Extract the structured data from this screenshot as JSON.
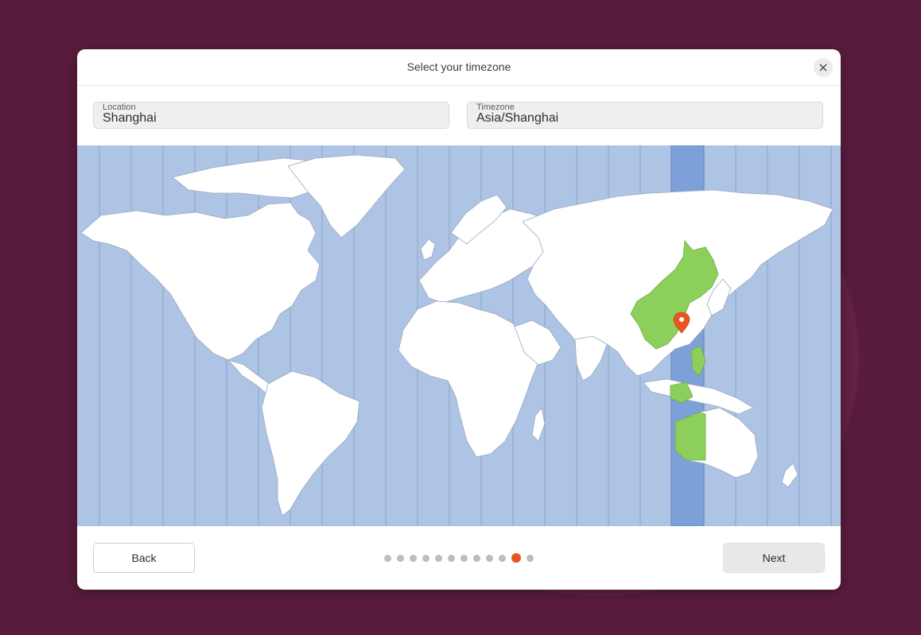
{
  "window": {
    "title": "Select your timezone",
    "close_icon": "close-icon"
  },
  "location": {
    "label": "Location",
    "value": "Shanghai"
  },
  "timezone": {
    "label": "Timezone",
    "value": "Asia/Shanghai"
  },
  "map": {
    "selected_zone": "UTC+8",
    "marker_icon": "location-pin-icon",
    "colors": {
      "ocean": "#aec4e4",
      "land": "#ffffff",
      "selected_band": "#7ea0d8",
      "selected_country": "#8ccf5b",
      "marker": "#e95420"
    }
  },
  "footer": {
    "back_label": "Back",
    "next_label": "Next",
    "progress": {
      "total": 12,
      "current": 11
    }
  },
  "colors": {
    "accent": "#e95420",
    "background": "#5a1c3e"
  }
}
